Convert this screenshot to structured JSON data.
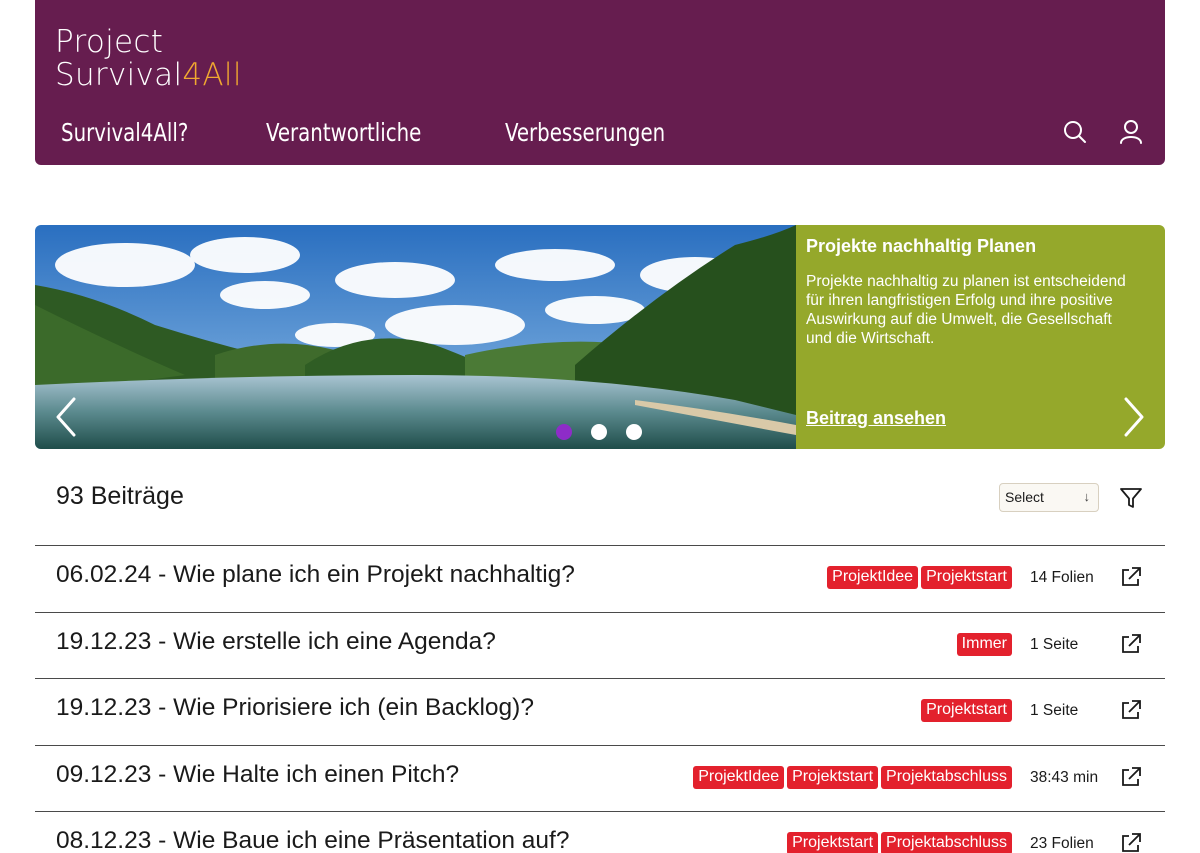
{
  "header": {
    "logo_line1": "Project",
    "logo_line2_main": "Survival",
    "logo_line2_accent": "4All",
    "nav": [
      "Survival4All?",
      "Verantwortliche",
      "Verbesserungen"
    ],
    "icons": [
      "search-icon",
      "user-icon"
    ],
    "colors": {
      "background": "#661d4f",
      "accent": "#f0a830"
    }
  },
  "hero": {
    "title": "Projekte nachhaltig Planen",
    "text": "Projekte nachhaltig zu planen ist entscheidend für ihren langfristigen Erfolg und ihre positive Auswirkung auf die Umwelt, die Gesellschaft und die Wirtschaft.",
    "link": "Beitrag ansehen",
    "slide_count": 3,
    "active_slide": 1,
    "colors": {
      "panel": "#95a82b",
      "active_dot": "#8e2cc8"
    }
  },
  "toolbar": {
    "count": "93 Beiträge",
    "select_value": "Select",
    "select_arrow": "↓"
  },
  "posts": [
    {
      "title": "06.02.24 - Wie plane ich ein Projekt nachhaltig?",
      "tags": [
        "ProjektIdee",
        "Projektstart"
      ],
      "meta": "14 Folien"
    },
    {
      "title": "19.12.23 - Wie erstelle ich eine Agenda?",
      "tags": [
        "Immer"
      ],
      "meta": "1 Seite"
    },
    {
      "title": "19.12.23 - Wie Priorisiere ich (ein Backlog)?",
      "tags": [
        "Projektstart"
      ],
      "meta": "1 Seite"
    },
    {
      "title": "09.12.23 - Wie Halte ich einen Pitch?",
      "tags": [
        "ProjektIdee",
        "Projektstart",
        "Projektabschluss"
      ],
      "meta": "38:43 min"
    },
    {
      "title": "08.12.23 - Wie Baue ich eine Präsentation auf?",
      "tags": [
        "Projektstart",
        "Projektabschluss"
      ],
      "meta": "23 Folien"
    }
  ],
  "tag_color": "#e3212d"
}
